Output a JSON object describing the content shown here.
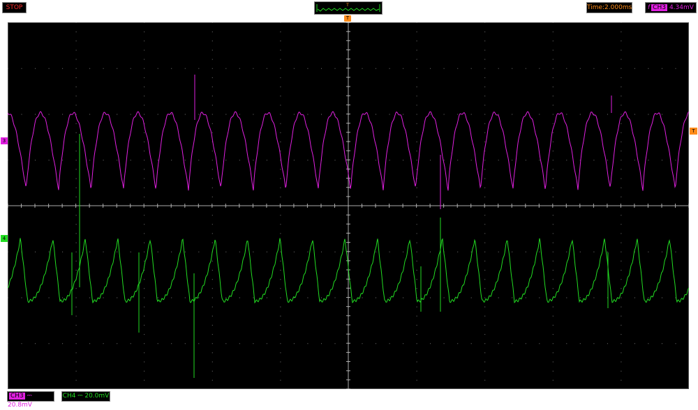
{
  "status": {
    "run_state": "STOP"
  },
  "timebase": {
    "label": "Time:2.000ms"
  },
  "trigger": {
    "edge_symbol": "f",
    "source": "CH3",
    "level": "4.34mV",
    "marker_label": "T"
  },
  "channels": {
    "ch3": {
      "marker": "3",
      "scale_tag": "CH3",
      "scale": "20.8mV",
      "color": "#e020e0"
    },
    "ch4": {
      "marker": "4",
      "scale": "CH4 ⎓ 20.0mV",
      "color": "#22dd22"
    }
  },
  "coupling_symbol": "⎓"
}
